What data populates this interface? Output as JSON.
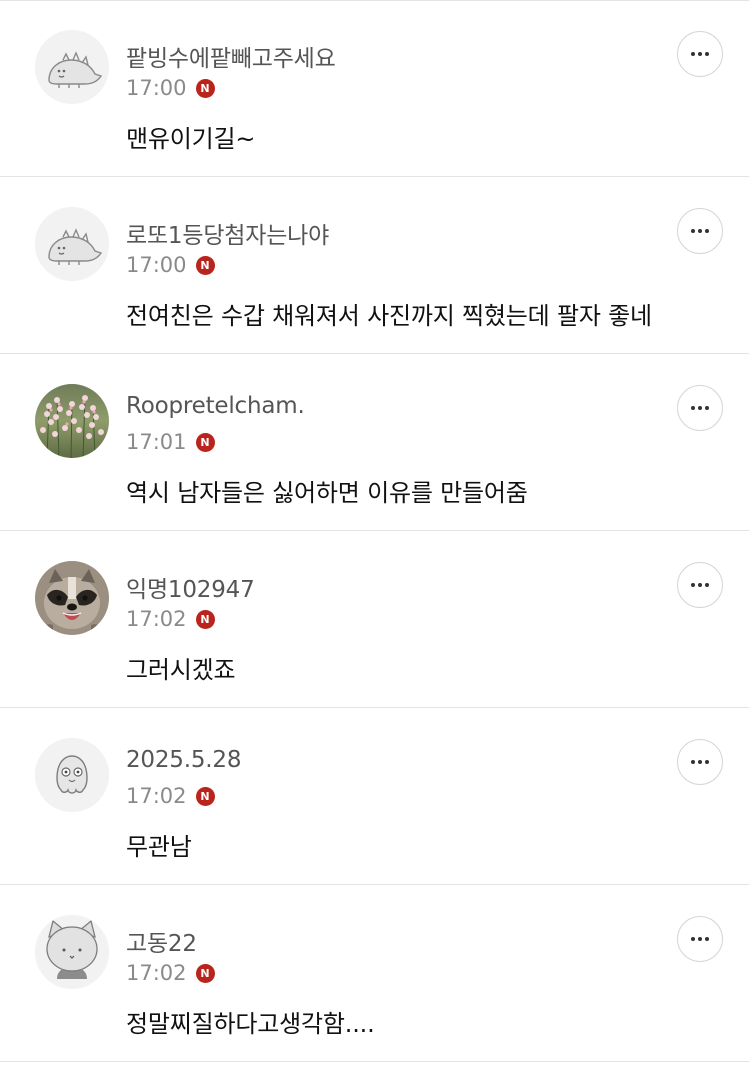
{
  "comments": [
    {
      "nickname": "팥빙수에팥빼고주세요",
      "time": "17:00",
      "badge": "N",
      "text": "맨유이기길~",
      "avatar_icon": "dinosaur-icon"
    },
    {
      "nickname": "로또1등당첨자는나야",
      "time": "17:00",
      "badge": "N",
      "text": "전여친은 수갑 채워져서 사진까지 찍혔는데 팔자 좋네",
      "avatar_icon": "dinosaur-icon"
    },
    {
      "nickname": "Roopretelcham.",
      "time": "17:01",
      "badge": "N",
      "text": "역시 남자들은 싫어하면 이유를 만들어줌",
      "avatar_icon": "flower-photo-icon"
    },
    {
      "nickname": "익명102947",
      "time": "17:02",
      "badge": "N",
      "text": "그러시겠죠",
      "avatar_icon": "raccoon-photo-icon"
    },
    {
      "nickname": "2025.5.28",
      "time": "17:02",
      "badge": "N",
      "text": "무관남",
      "avatar_icon": "octopus-icon"
    },
    {
      "nickname": "고동22",
      "time": "17:02",
      "badge": "N",
      "text": "정말찌질하다고생각함....",
      "avatar_icon": "cat-icon"
    }
  ],
  "colors": {
    "badge": "#b9251d",
    "divider": "#e3e3e3",
    "nickname": "#555555",
    "time": "#8a8a8a",
    "text": "#111111"
  },
  "more_icon": "more-horizontal-icon"
}
